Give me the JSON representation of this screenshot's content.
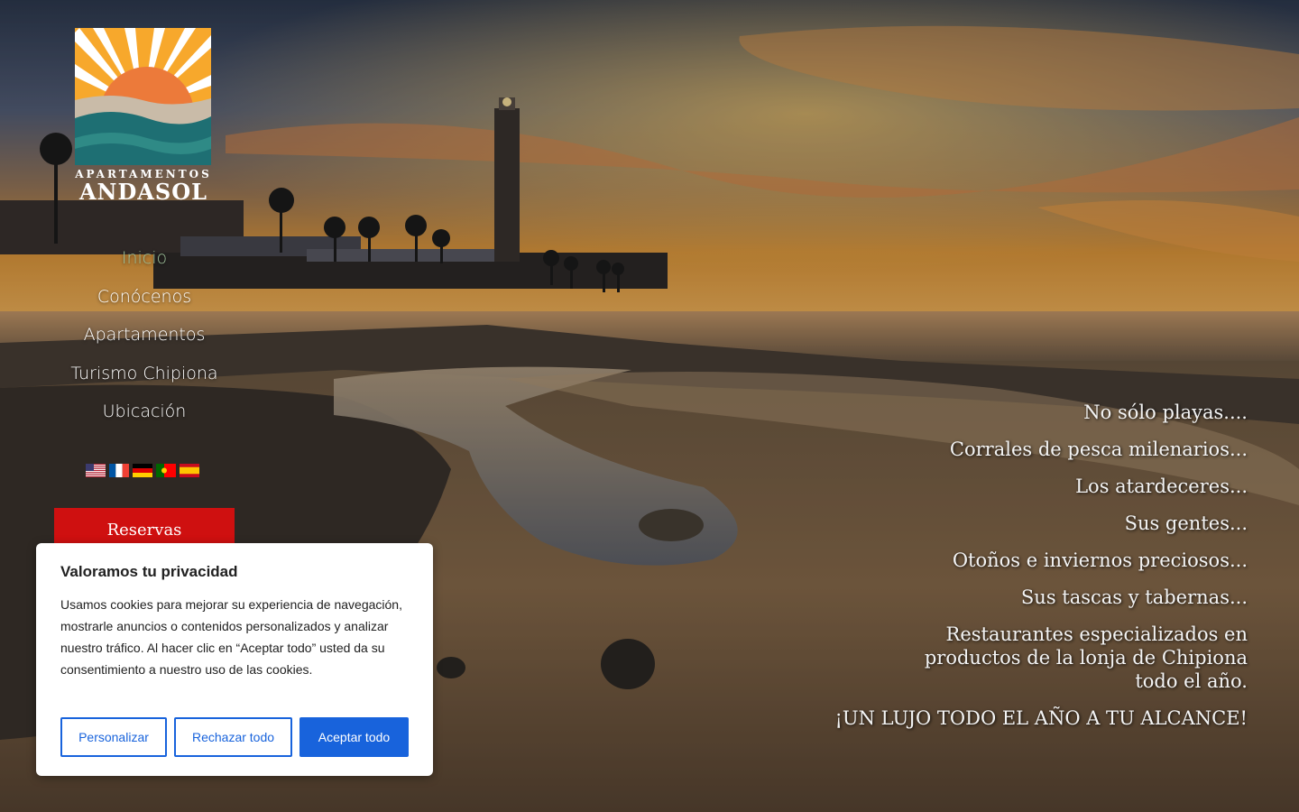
{
  "brand": {
    "subtitle": "APARTAMENTOS",
    "name": "ANDASOL",
    "colors": {
      "sun": "#ec7a3a",
      "sky": "#f7a82c",
      "sea": "#1e6f73",
      "sand": "#c9bba8"
    }
  },
  "nav": {
    "items": [
      {
        "label": "Inicio",
        "active": true
      },
      {
        "label": "Conócenos",
        "active": false
      },
      {
        "label": "Apartamentos",
        "active": false
      },
      {
        "label": "Turismo Chipiona",
        "active": false
      },
      {
        "label": "Ubicación",
        "active": false
      }
    ],
    "active_color": "#9fc29a"
  },
  "languages": [
    "us-flag-icon",
    "france-flag-icon",
    "germany-flag-icon",
    "portugal-flag-icon",
    "spain-flag-icon"
  ],
  "reserve": {
    "label": "Reservas",
    "color": "#cf1010"
  },
  "taglines": [
    "No sólo playas....",
    "Corrales de pesca milenarios...",
    "Los atardeceres...",
    "Sus gentes...",
    "Otoños e inviernos preciosos...",
    "Sus tascas y tabernas...",
    "Restaurantes especializados en productos de la lonja de Chipiona todo el año.",
    "¡UN LUJO TODO EL AÑO A TU ALCANCE!"
  ],
  "cookie": {
    "title": "Valoramos tu privacidad",
    "text": "Usamos cookies para mejorar su experiencia de navegación, mostrarle anuncios o contenidos personalizados y analizar nuestro tráfico. Al hacer clic en “Aceptar todo” usted da su consentimiento a nuestro uso de las cookies.",
    "customize_label": "Personalizar",
    "reject_label": "Rechazar todo",
    "accept_label": "Aceptar todo",
    "accent_color": "#1863dc"
  }
}
